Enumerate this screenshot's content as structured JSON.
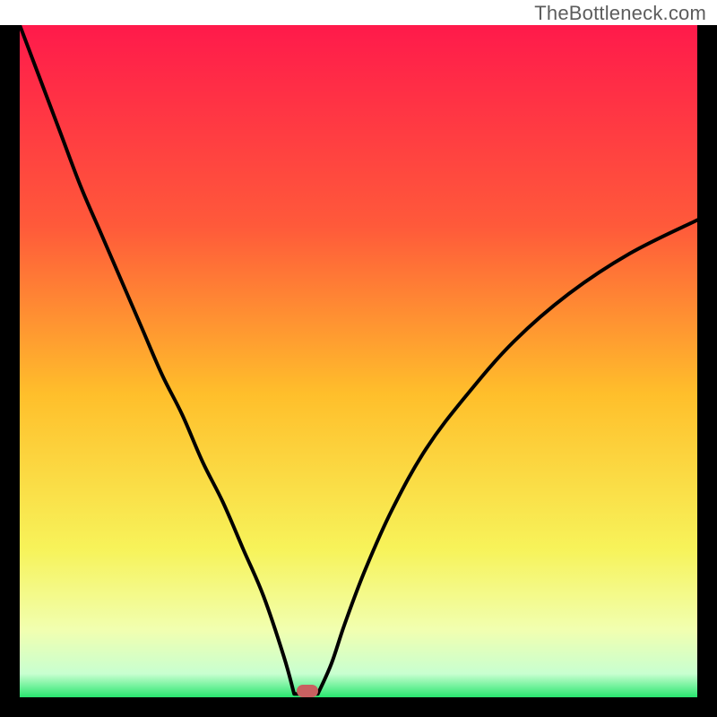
{
  "watermark": "TheBottleneck.com",
  "chart_data": {
    "type": "line",
    "title": "",
    "xlabel": "",
    "ylabel": "",
    "xlim": [
      0,
      100
    ],
    "ylim": [
      0,
      100
    ],
    "gradient_stops": [
      {
        "offset": 0,
        "color": "#ff1a4b"
      },
      {
        "offset": 0.3,
        "color": "#ff5a3a"
      },
      {
        "offset": 0.55,
        "color": "#ffbf2b"
      },
      {
        "offset": 0.78,
        "color": "#f7f35a"
      },
      {
        "offset": 0.9,
        "color": "#f1ffb0"
      },
      {
        "offset": 0.965,
        "color": "#c8ffd0"
      },
      {
        "offset": 1.0,
        "color": "#28e66f"
      }
    ],
    "series": [
      {
        "name": "left-branch",
        "x": [
          0.0,
          3,
          6,
          9,
          12,
          15,
          18,
          21,
          24,
          27,
          30,
          33,
          36,
          39,
          40.5
        ],
        "y": [
          100,
          92,
          84,
          76,
          69,
          62,
          55,
          48,
          42,
          35,
          29,
          22,
          15,
          6,
          0.5
        ]
      },
      {
        "name": "right-branch",
        "x": [
          44,
          46,
          48,
          51,
          55,
          60,
          66,
          73,
          81,
          90,
          100
        ],
        "y": [
          0.5,
          5,
          11,
          19,
          28,
          37,
          45,
          53,
          60,
          66,
          71
        ]
      }
    ],
    "flat_segment": {
      "x0": 40.5,
      "x1": 44,
      "y": 0.5
    },
    "marker": {
      "x": 42.5,
      "y": 0.9,
      "color": "#c86060"
    }
  }
}
